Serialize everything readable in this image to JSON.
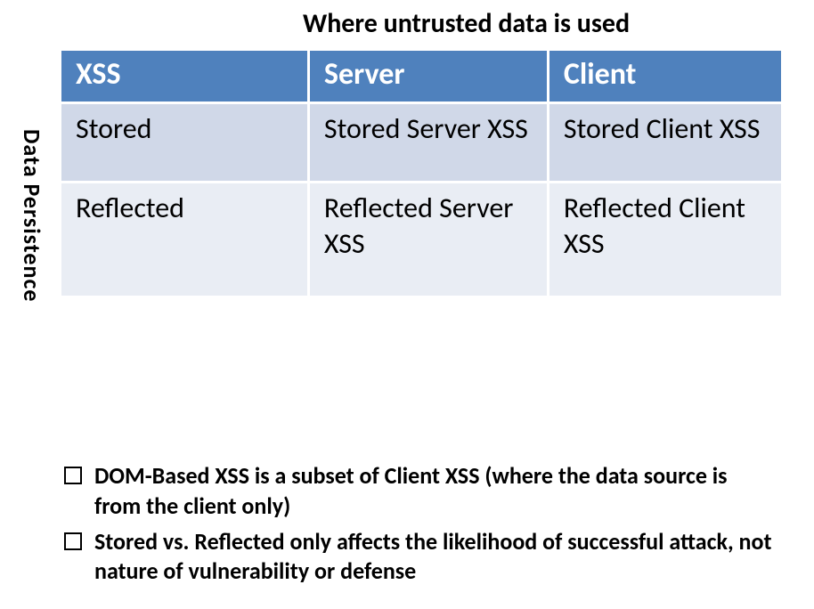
{
  "title_top": "Where untrusted data is used",
  "side_label": "Data Persistence",
  "chart_data": {
    "type": "table",
    "title": "Where untrusted data is used",
    "xlabel": "Where untrusted data is used",
    "ylabel": "Data Persistence",
    "headers": [
      "XSS",
      "Server",
      "Client"
    ],
    "rows": [
      [
        "Stored",
        "Stored Server XSS",
        "Stored Client XSS"
      ],
      [
        "Reflected",
        "Reflected Server XSS",
        "Reflected Client XSS"
      ]
    ]
  },
  "table": {
    "headers": {
      "c0": "XSS",
      "c1": "Server",
      "c2": "Client"
    },
    "rows": [
      {
        "c0": "Stored",
        "c1": "Stored Server XSS",
        "c2": "Stored Client XSS"
      },
      {
        "c0": "Reflected",
        "c1": "Reflected Server XSS",
        "c2": "Reflected Client XSS"
      }
    ]
  },
  "bullets": [
    "DOM-Based XSS is a subset of Client XSS (where the data source is from the client only)",
    "Stored vs. Reflected only affects the likelihood of successful attack, not nature of vulnerability or defense"
  ]
}
